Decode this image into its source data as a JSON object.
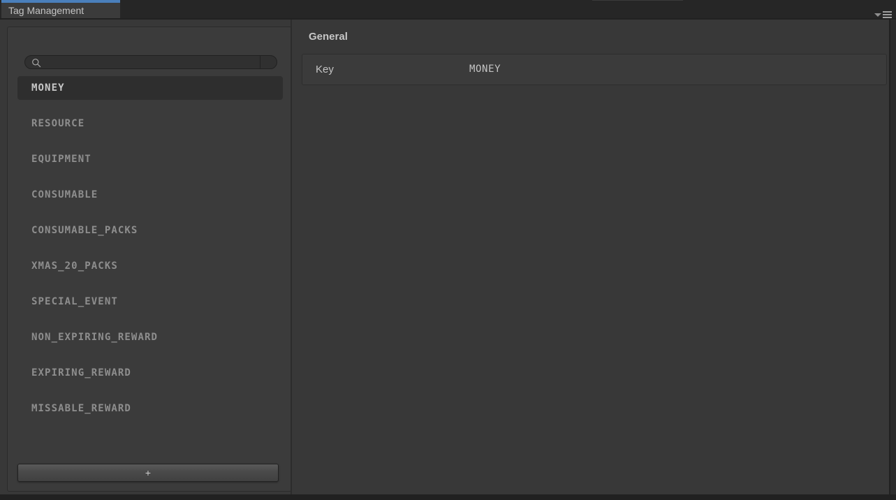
{
  "window": {
    "tab_label": "Tag Management",
    "accent_color": "#4a7fbb",
    "menu": {
      "caret_icon": "chevron-down-icon",
      "hamburger_icon": "hamburger-menu-icon"
    }
  },
  "left_panel": {
    "search": {
      "value": "",
      "placeholder": "",
      "icon": "search-icon"
    },
    "items": [
      {
        "label": "MONEY",
        "selected": true
      },
      {
        "label": "RESOURCE",
        "selected": false
      },
      {
        "label": "EQUIPMENT",
        "selected": false
      },
      {
        "label": "CONSUMABLE",
        "selected": false
      },
      {
        "label": "CONSUMABLE_PACKS",
        "selected": false
      },
      {
        "label": "XMAS_20_PACKS",
        "selected": false
      },
      {
        "label": "SPECIAL_EVENT",
        "selected": false
      },
      {
        "label": "NON_EXPIRING_REWARD",
        "selected": false
      },
      {
        "label": "EXPIRING_REWARD",
        "selected": false
      },
      {
        "label": "MISSABLE_REWARD",
        "selected": false
      }
    ],
    "add_button_label": "+"
  },
  "right_panel": {
    "section_title": "General",
    "fields": [
      {
        "label": "Key",
        "value": "MONEY"
      }
    ]
  }
}
